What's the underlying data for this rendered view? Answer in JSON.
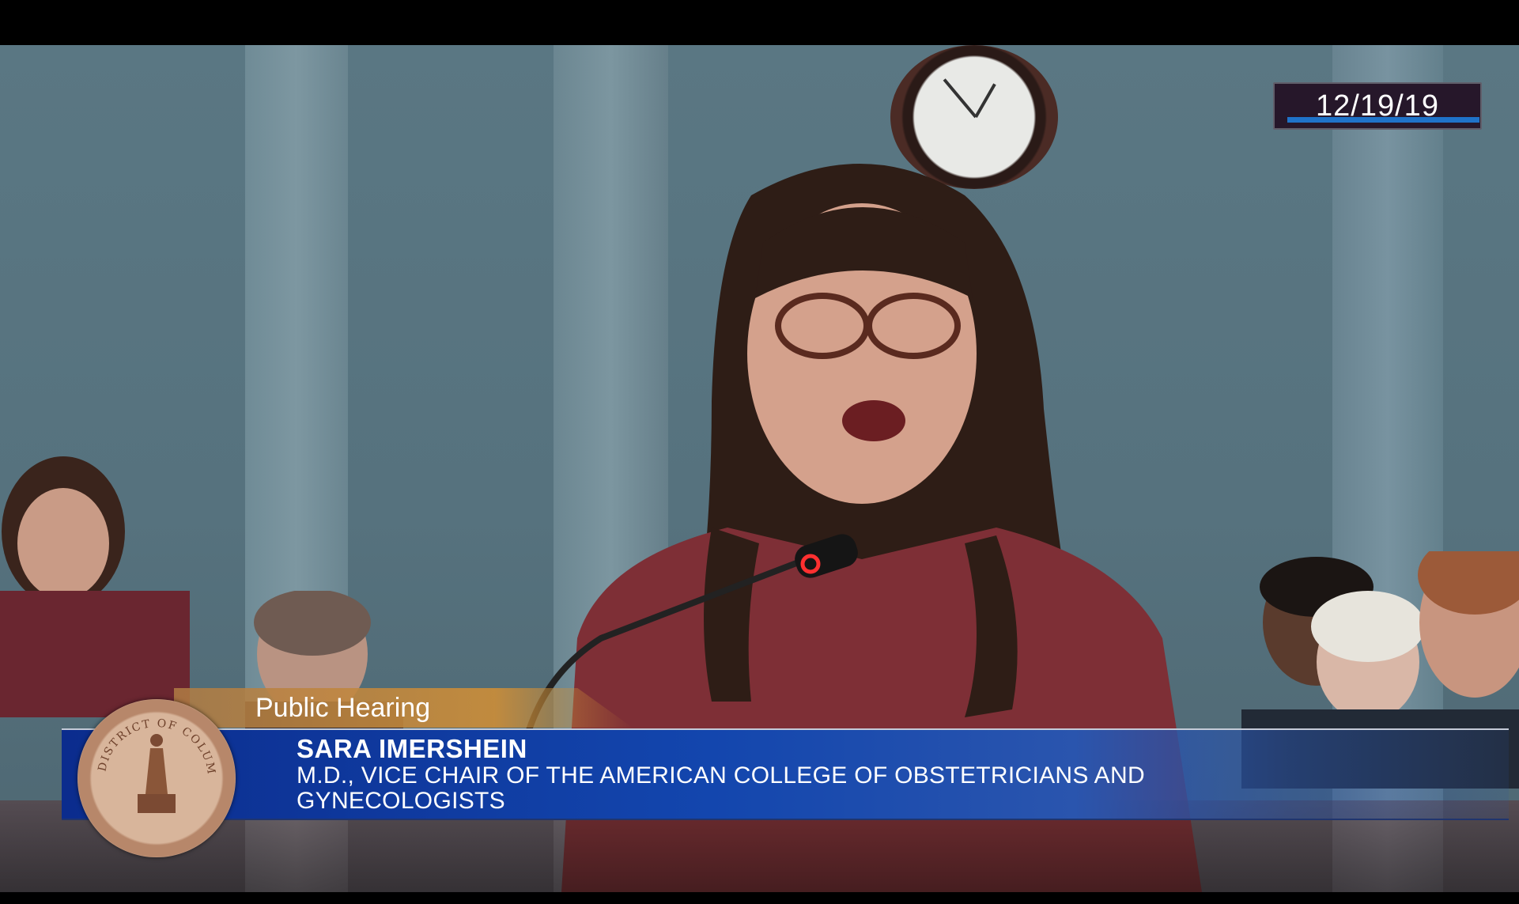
{
  "broadcast": {
    "date": "12/19/19",
    "segment_title": "Public Hearing",
    "speaker_name": "SARA IMERSHEIN",
    "speaker_title": "M.D., VICE CHAIR OF THE AMERICAN COLLEGE OF OBSTETRICIANS AND GYNECOLOGISTS",
    "seal_text": "DISTRICT OF COLUMBIA"
  },
  "colors": {
    "accent_blue": "#1346ae",
    "title_orange": "#cd8e38",
    "date_box": "#26172a"
  }
}
